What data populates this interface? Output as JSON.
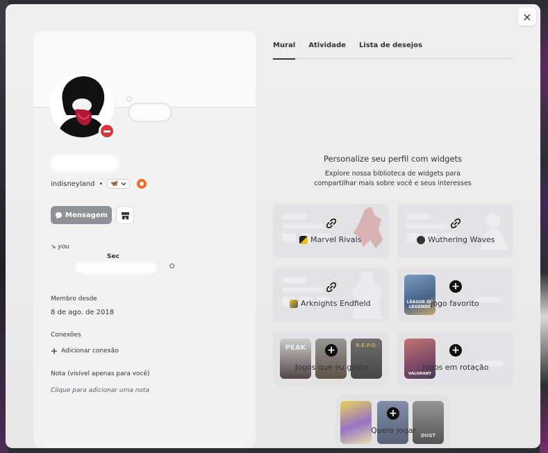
{
  "modal": {
    "close_label": "×"
  },
  "profile": {
    "username": "indisneyland",
    "separator": "•",
    "tag": "🦋",
    "message_label": "Mensagem",
    "status_prefix": "↘ you",
    "status_title": "Sec",
    "member_since_label": "Membro desde",
    "member_since_value": "8 de ago. de 2018",
    "connections_label": "Conexões",
    "add_connection_label": "Adicionar conexão",
    "note_label": "Nota (visível apenas para você)",
    "note_placeholder": "Clique para adicionar uma nota"
  },
  "tabs": [
    {
      "label": "Mural"
    },
    {
      "label": "Atividade"
    },
    {
      "label": "Lista de desejos"
    }
  ],
  "widgets_prompt": {
    "title": "Personalize seu perfil com widgets",
    "subtitle_line1": "Explore nossa biblioteca de widgets para",
    "subtitle_line2": "compartilhar mais sobre você e seus interesses"
  },
  "widgets": [
    {
      "label": "Marvel Rivals",
      "icon": "link-icon"
    },
    {
      "label": "Wuthering Waves",
      "icon": "link-icon"
    },
    {
      "label": "Arknights Endfield",
      "icon": "link-icon"
    },
    {
      "label": "Jogo favorito",
      "icon": "plus-icon",
      "cover": "LEAGUE OF LEGENDS"
    },
    {
      "label": "Jogos que eu gosto",
      "icon": "plus-icon",
      "covers": [
        "PEAK",
        "",
        "R.E.P.O."
      ]
    },
    {
      "label": "Jogos em rotação",
      "icon": "plus-icon",
      "cover": "VALORANT"
    },
    {
      "label": "Quero jogar",
      "icon": "plus-icon",
      "covers": [
        "",
        "",
        "DUST"
      ]
    }
  ],
  "colors": {
    "accent": "#313338",
    "dnd": "#da373c",
    "badge": "#f06b2a",
    "button": "#8e9297"
  }
}
